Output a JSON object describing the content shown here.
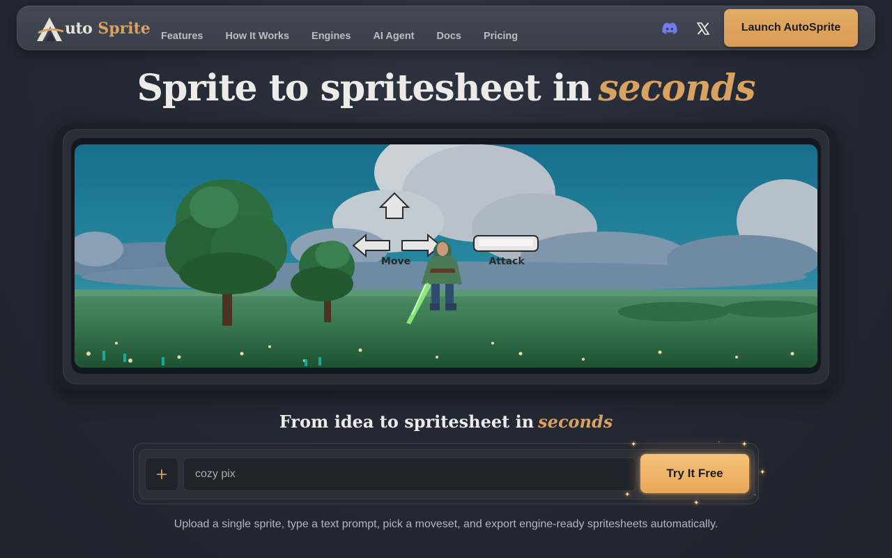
{
  "nav": {
    "logo_part1": "uto",
    "logo_part2": "Sprite",
    "links": [
      "Features",
      "How It Works",
      "Engines",
      "AI Agent",
      "Docs",
      "Pricing"
    ],
    "discord_icon": "discord-icon",
    "x_icon": "x-twitter-icon",
    "launch_label": "Launch AutoSprite"
  },
  "hero": {
    "title_main": "Sprite to spritesheet in",
    "title_accent": "seconds",
    "scene": {
      "controls": {
        "move_label": "Move",
        "attack_label": "Attack"
      }
    }
  },
  "prompt": {
    "title_main": "From idea to spritesheet in",
    "title_accent": "seconds",
    "add_icon": "plus-icon",
    "input_value": "cozy pix",
    "try_label": "Try It Free",
    "description": "Upload a single sprite, type a text prompt, pick a moveset, and export engine-ready spritesheets automatically."
  },
  "colors": {
    "accent": "#d9a260",
    "button": "#e4ac64",
    "background": "#252a34"
  }
}
